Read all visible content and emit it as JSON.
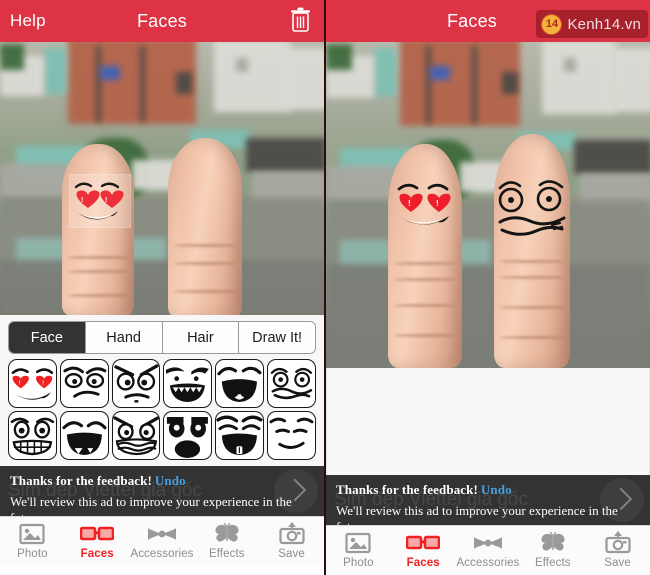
{
  "app": {
    "accent_red": "#dd3344",
    "active_red": "#ee2222",
    "banner_bg": "#333333"
  },
  "left_panel": {
    "topbar": {
      "help_label": "Help",
      "title": "Faces",
      "trash_icon": "trash-icon"
    }
  },
  "right_panel": {
    "topbar": {
      "title": "Faces",
      "watermark_badge": "14",
      "watermark_text": "Kenh14.vn"
    }
  },
  "controls": {
    "segments": [
      {
        "label": "Face",
        "active": true
      },
      {
        "label": "Hand",
        "active": false
      },
      {
        "label": "Hair",
        "active": false
      },
      {
        "label": "Draw It!",
        "active": false
      }
    ],
    "stickers": [
      {
        "name": "heart-eyes-smile-face"
      },
      {
        "name": "skeptical-smirk-face"
      },
      {
        "name": "angry-frown-face"
      },
      {
        "name": "grinning-wide-mouth-face"
      },
      {
        "name": "laughing-open-mouth-face"
      },
      {
        "name": "wavy-mouth-wide-eyes-face"
      },
      {
        "name": "big-grin-teeth-face"
      },
      {
        "name": "happy-open-mouth-face"
      },
      {
        "name": "gritted-teeth-angry-face"
      },
      {
        "name": "shocked-dark-eyes-face"
      },
      {
        "name": "cheerful-tooth-face"
      },
      {
        "name": "smug-line-face"
      }
    ]
  },
  "ad_banner": {
    "line1": "Thanks for the feedback!",
    "undo_label": "Undo",
    "line2": "We'll review this ad to improve your experience in the future.",
    "ghost_text": "Sim đẹp Viettel giá gốc",
    "chevron_icon": "chevron-right-icon"
  },
  "tabbar": {
    "items": [
      {
        "label": "Photo",
        "icon": "photo-icon",
        "active": false
      },
      {
        "label": "Faces",
        "icon": "glasses-icon",
        "active": true
      },
      {
        "label": "Accessories",
        "icon": "bowtie-icon",
        "active": false
      },
      {
        "label": "Effects",
        "icon": "butterfly-icon",
        "active": false
      },
      {
        "label": "Save",
        "icon": "camera-upload-icon",
        "active": false
      }
    ]
  },
  "photo": {
    "description": "blurred rooftop cityscape with two fingers",
    "left_faces": [
      "heart-eyes-smile-face"
    ],
    "right_faces": [
      "heart-eyes-smile-face",
      "wavy-mouth-wide-eyes-face"
    ]
  }
}
